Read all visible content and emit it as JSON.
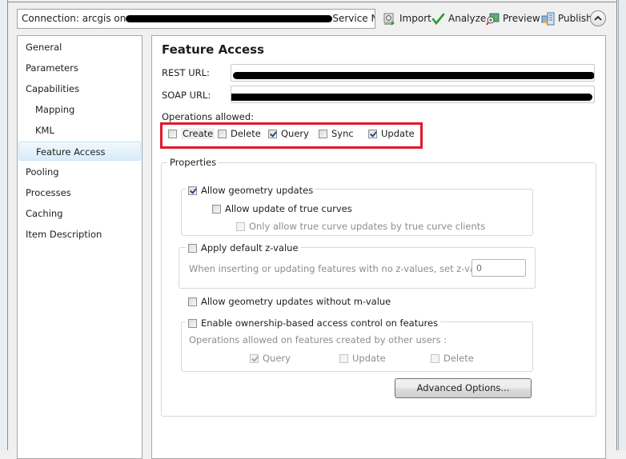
{
  "connection": {
    "prefix": "Connection: arcgis on",
    "suffix": "Service Na..."
  },
  "toolbar": {
    "import_label": "Import",
    "analyze_label": "Analyze",
    "preview_label": "Preview",
    "publish_label": "Publish"
  },
  "sidebar": {
    "items": [
      {
        "label": "General",
        "level": 0
      },
      {
        "label": "Parameters",
        "level": 0
      },
      {
        "label": "Capabilities",
        "level": 0
      },
      {
        "label": "Mapping",
        "level": 1
      },
      {
        "label": "KML",
        "level": 1
      },
      {
        "label": "Feature Access",
        "level": 1,
        "selected": true
      },
      {
        "label": "Pooling",
        "level": 0
      },
      {
        "label": "Processes",
        "level": 0
      },
      {
        "label": "Caching",
        "level": 0
      },
      {
        "label": "Item Description",
        "level": 0
      }
    ]
  },
  "main": {
    "title": "Feature Access",
    "rest_url_label": "REST URL:",
    "soap_url_label": "SOAP URL:",
    "operations_label": "Operations allowed:",
    "operations": [
      {
        "label": "Create",
        "checked": false
      },
      {
        "label": "Delete",
        "checked": false
      },
      {
        "label": "Query",
        "checked": true
      },
      {
        "label": "Sync",
        "checked": false
      },
      {
        "label": "Update",
        "checked": true
      }
    ],
    "highlight_color": "#e0192b",
    "properties": {
      "legend": "Properties",
      "allow_geometry_updates": {
        "label": "Allow geometry updates",
        "checked": true
      },
      "allow_true_curves": {
        "label": "Allow update of true curves",
        "checked": false
      },
      "only_true_curve_clients": {
        "label": "Only allow true curve updates by true curve clients",
        "checked": false,
        "disabled": true
      },
      "apply_default_z": {
        "label": "Apply default z-value",
        "checked": false
      },
      "z_value_prompt": "When inserting or updating features with no z-values, set z-value to:",
      "z_value": "0",
      "without_m_value": {
        "label": "Allow geometry updates without m-value",
        "checked": false
      },
      "ownership": {
        "label": "Enable ownership-based access control on features",
        "checked": false
      },
      "ownership_prompt": "Operations allowed on features created by other users :",
      "ownership_ops": [
        {
          "label": "Query",
          "checked": true,
          "disabled": true
        },
        {
          "label": "Update",
          "checked": false,
          "disabled": true
        },
        {
          "label": "Delete",
          "checked": false,
          "disabled": true
        }
      ]
    },
    "advanced_button": "Advanced Options..."
  }
}
